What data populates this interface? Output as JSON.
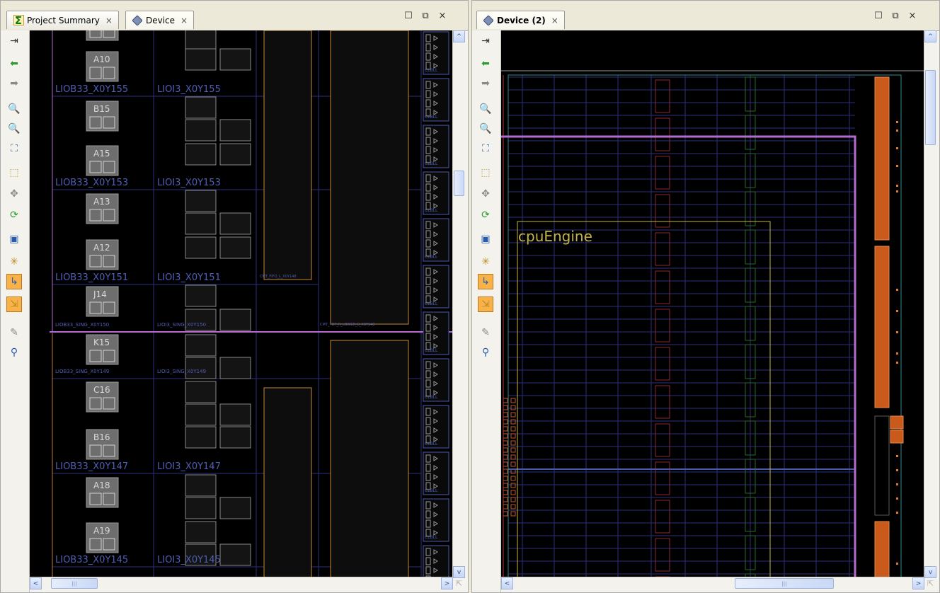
{
  "left_panel": {
    "tabs": [
      {
        "label": "Project Summary",
        "icon": "sigma-icon",
        "close": "×"
      },
      {
        "label": "Device",
        "icon": "device-icon",
        "close": "×"
      }
    ],
    "window_controls": {
      "maximize": "☐",
      "restore": "⧉",
      "close": "×"
    },
    "pad_labels": [
      "A10",
      "B15",
      "A15",
      "A13",
      "A12",
      "J14",
      "K15",
      "C16",
      "B16",
      "A18",
      "A19"
    ],
    "tile_labels": [
      {
        "iob": "LIOB33_X0Y155",
        "ioi": "LIOI3_X0Y155"
      },
      {
        "iob": "LIOB33_X0Y153",
        "ioi": "LIOI3_X0Y153"
      },
      {
        "iob": "LIOB33_X0Y151",
        "ioi": "LIOI3_X0Y151"
      },
      {
        "iob": "LIOB33_SING_X0Y150",
        "ioi": "LIOI3_SING_X0Y150"
      },
      {
        "iob": "LIOB33_SING_X0Y149",
        "ioi": "LIOI3_SING_X0Y149"
      },
      {
        "iob": "LIOB33_X0Y147",
        "ioi": "LIOI3_X0Y147"
      },
      {
        "iob": "LIOB33_X0Y145",
        "ioi": "LIOI3_X0Y145"
      }
    ],
    "small_labels": [
      "CMT_FIFO_L_X0Y148",
      "CMT_TOP_R_LOWER_B_X8Y148"
    ],
    "scroll": {
      "left": "<",
      "right": ">",
      "up": "^",
      "down": "v",
      "grip": "|||"
    }
  },
  "right_panel": {
    "tabs": [
      {
        "label": "Device (2)",
        "icon": "device-icon",
        "close": "×"
      }
    ],
    "window_controls": {
      "maximize": "☐",
      "restore": "⧉",
      "close": "×"
    },
    "pblock_label": "cpuEngine",
    "scroll": {
      "left": "<",
      "right": ">",
      "up": "^",
      "down": "v",
      "grip": "|||"
    }
  },
  "toolbar_icons": [
    "collapse-icon",
    "back-arrow-icon",
    "forward-arrow-icon",
    "zoom-in-icon",
    "zoom-out-icon",
    "zoom-fit-icon",
    "select-area-icon",
    "move-icon",
    "refresh-icon",
    "add-pblock-icon",
    "fit-selection-icon",
    "route-icon",
    "mark-icon",
    "pin-icon",
    "search-routing-icon"
  ],
  "colors": {
    "canvas_bg": "#000000",
    "tile_border": "#2b2f7a",
    "pad_fill": "#6e6e6e",
    "orange": "#d2692a",
    "magenta": "#b36ad1",
    "pblock_yellow": "#c3b44a"
  }
}
